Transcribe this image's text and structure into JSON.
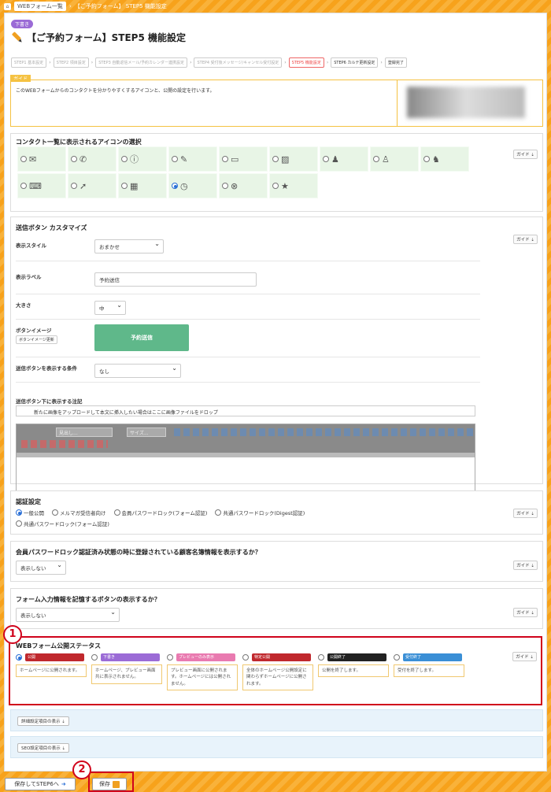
{
  "breadcrumb": {
    "home_icon": "home-icon",
    "items": [
      "WEBフォーム一覧",
      "【ご予約フォーム】 STEP5 機能設定"
    ]
  },
  "status_badge": "下書き",
  "page_title": "【ご予約フォーム】STEP5 機能設定",
  "steps": [
    {
      "label": "STEP1 基本設定",
      "state": "normal"
    },
    {
      "label": "STEP2 項目設定",
      "state": "normal"
    },
    {
      "label": "STEP3 自動返信メール/予約カレンダー連携設定",
      "state": "normal"
    },
    {
      "label": "STEP4 受付後メッセージ/キャンセル受付設定",
      "state": "normal"
    },
    {
      "label": "STEP5 機能設定",
      "state": "active"
    },
    {
      "label": "STEP6 カルテ更新設定",
      "state": "done"
    },
    {
      "label": "登録完了",
      "state": "done"
    }
  ],
  "guide": {
    "tag": "ガイド",
    "text": "このWEBフォームからのコンタクトを分かりやすくするアイコンと、公開の設定を行います。"
  },
  "guide_button": "ガイド ⇣",
  "icon_section": {
    "title": "コンタクト一覧に表示されるアイコンの選択",
    "icons": [
      "✉",
      "✆",
      "ⓘ",
      "✎",
      "▭",
      "▨",
      "♟",
      "♙",
      "♞",
      "⌨",
      "➚",
      "▦",
      "◷",
      "⊗",
      "★"
    ],
    "icon_names": [
      "mail-icon",
      "phone-icon",
      "info-icon",
      "pencil-icon",
      "monitor-icon",
      "note-icon",
      "person-icon",
      "person2-icon",
      "group-icon",
      "keyboard-icon",
      "arrow-icon",
      "calendar-icon",
      "clock-icon",
      "cancel-icon",
      "star-icon"
    ],
    "selected_index": 12
  },
  "button_section": {
    "title": "送信ボタン カスタマイズ",
    "style_label": "表示スタイル",
    "style_value": "おまかせ",
    "label_label": "表示ラベル",
    "label_value": "予約送信",
    "size_label": "大きさ",
    "size_value": "中",
    "image_label": "ボタンイメージ",
    "image_update": "ボタンイメージ更新",
    "preview_text": "予約送信",
    "condition_label": "送信ボタンを表示する条件",
    "condition_value": "なし",
    "note_label": "送信ボタン下に表示する注記",
    "drop_text": "新たに画像をアップロードして本文に挿入したい場合はここに画像ファイルをドロップ",
    "toolbar_heading": "見出し...",
    "toolbar_size": "サイズ..."
  },
  "auth_section": {
    "title": "認証設定",
    "options": [
      "一般公開",
      "メルマガ受信者向け",
      "会員パスワードロック(フォーム認証)",
      "共通パスワードロック(Digest認証)",
      "共通パスワードロック(フォーム認証)"
    ],
    "selected_index": 0
  },
  "member_section": {
    "title": "会員パスワードロック認証済み状態の時に登録されている顧客名簿情報を表示するか？",
    "value": "表示しない"
  },
  "remember_section": {
    "title": "フォーム入力情報を記憶するボタンの表示するか？",
    "value": "表示しない"
  },
  "publish_section": {
    "title": "WEBフォーム公開ステータス",
    "marker": "1",
    "statuses": [
      {
        "label": "公開",
        "color": "#c0282d",
        "desc": "ホームページに公開されます。"
      },
      {
        "label": "下書き",
        "color": "#9b6bd6",
        "desc": "ホームページ、プレビュー画面共に表示されません。"
      },
      {
        "label": "プレビューのみ表示",
        "color": "#e97ab0",
        "desc": "プレビュー画面に公開されます。ホームページには公開されません。"
      },
      {
        "label": "特定公開",
        "color": "#c0282d",
        "desc": "全体のホームページ公開設定に関わらずホームページに公開されます。"
      },
      {
        "label": "公開終了",
        "color": "#222222",
        "desc": "公開を終了します。"
      },
      {
        "label": "受付終了",
        "color": "#3a8fd6",
        "desc": "受付を終了します。"
      }
    ],
    "selected_index": 0
  },
  "collapse": {
    "detail": "詳細設定項目の表示 ⇣",
    "seo": "SEO設定項目の表示 ⇣"
  },
  "bottom": {
    "save_next": "保存してSTEP6へ",
    "save": "保存",
    "marker": "2"
  }
}
